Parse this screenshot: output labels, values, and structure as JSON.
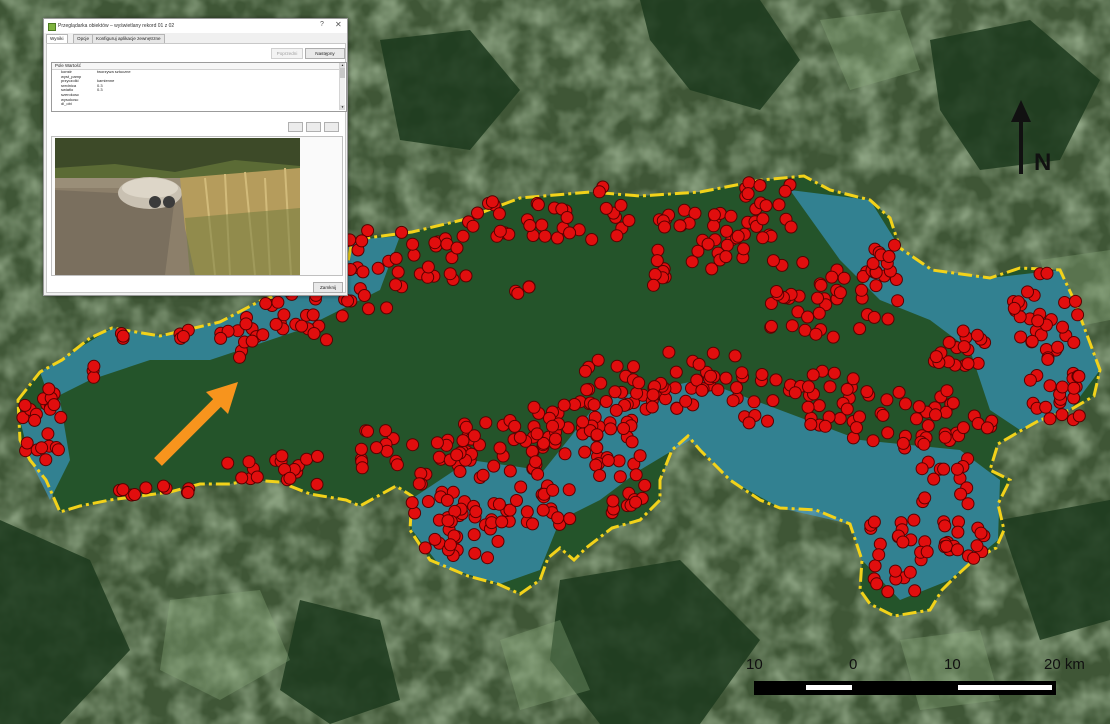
{
  "dialog": {
    "title": "Przeglądarka obiektów – wyświetlany rekord 01 z 02",
    "help_symbol": "?",
    "close_symbol": "✕",
    "tabs": [
      {
        "label": "Wyniki"
      },
      {
        "label": "Opcje"
      },
      {
        "label": "Konfiguruj aplikacje zewnętrzne"
      }
    ],
    "prev_label": "Poprzedni",
    "next_label": "Następny",
    "table": {
      "headers": [
        "Pole",
        "Wartość"
      ],
      "rows": [
        {
          "field": "konstr",
          "value": "tworzywa sztuczne"
        },
        {
          "field": "wyst_pamp",
          "value": ""
        },
        {
          "field": "przyczolki",
          "value": "kamienne"
        },
        {
          "field": "srednica",
          "value": "0.3"
        },
        {
          "field": "swiatlo",
          "value": "0.3"
        },
        {
          "field": "szerokosc",
          "value": ""
        },
        {
          "field": "wysokosc",
          "value": ""
        },
        {
          "field": "dl_obi",
          "value": ""
        }
      ]
    },
    "close_label": "Zamknij"
  },
  "map": {
    "north_label": "N",
    "scale_labels": [
      "10",
      "0",
      "10",
      "20 km"
    ],
    "colors": {
      "boundary": "#f2d21a",
      "points": "#e10e0e",
      "water": "#4aa8e0",
      "forest": "#1f4a1f",
      "arrow": "#f7941d"
    }
  }
}
